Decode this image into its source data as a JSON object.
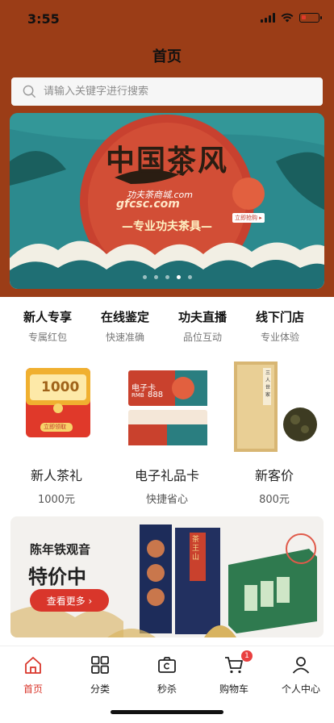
{
  "status_bar": {
    "time": "3:55"
  },
  "nav": {
    "title": "首页"
  },
  "search": {
    "placeholder": "请输入关键字进行搜索"
  },
  "banner": {
    "title": "中国茶风",
    "domain_cn": "功夫茶商城.com",
    "domain": "gfcsc.com",
    "slogan": "—专业功夫茶具—",
    "tag": "立即抢购 ▸",
    "dots": 5,
    "active_dot": 3
  },
  "features": [
    {
      "title": "新人专享",
      "subtitle": "专属红包"
    },
    {
      "title": "在线鉴定",
      "subtitle": "快速准确"
    },
    {
      "title": "功夫直播",
      "subtitle": "品位互动"
    },
    {
      "title": "线下门店",
      "subtitle": "专业体验"
    }
  ],
  "products": [
    {
      "name": "新人茶礼",
      "price": "1000元",
      "pic_value": "1000",
      "pic_button": "立即领取"
    },
    {
      "name": "电子礼品卡",
      "price": "快捷省心",
      "pic_card_title": "电子卡",
      "pic_card_value": "888",
      "pic_card_unit": "RMB"
    },
    {
      "name": "新客价",
      "price": "800元",
      "pic_box_text": "三人世家"
    }
  ],
  "promo": {
    "name": "陈年铁观音",
    "title": "特价中",
    "button": "查看更多 ›",
    "box_text": "茶王山"
  },
  "tabbar": [
    {
      "label": "首页",
      "icon": "home-icon",
      "active": true
    },
    {
      "label": "分类",
      "icon": "grid-icon",
      "active": false
    },
    {
      "label": "秒杀",
      "icon": "flash-sale-icon",
      "active": false
    },
    {
      "label": "购物车",
      "icon": "cart-icon",
      "active": false,
      "badge": "1"
    },
    {
      "label": "个人中心",
      "icon": "user-icon",
      "active": false
    }
  ],
  "colors": {
    "header": "#9b3d17",
    "accent": "#d9362b",
    "banner_teal": "#2c8a8e"
  }
}
